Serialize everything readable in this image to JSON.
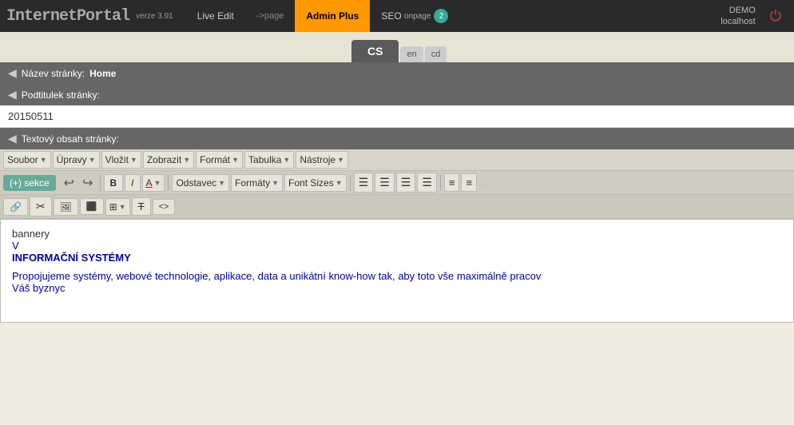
{
  "logo": {
    "text": "InternetPortal",
    "version_label": "verze 3.91"
  },
  "topnav": {
    "live_edit": "Live Edit",
    "arrow_page": "->page",
    "admin_plus": "Admin Plus",
    "seo": "SEO",
    "seo_sub": "onpage",
    "seo_count": "2",
    "demo_label": "DEMO",
    "localhost_label": "localhost",
    "power_icon": "⏻"
  },
  "lang_tabs": {
    "active": "CS",
    "options": [
      "en",
      "cd"
    ]
  },
  "fields": {
    "page_name_label": "Název stránky:",
    "page_name_value": "Home",
    "subtitle_label": "Podtitulek stránky:",
    "subtitle_value": "20150511",
    "content_label": "Textový obsah stránky:"
  },
  "toolbar_row1": {
    "soubor": "Soubor",
    "upravy": "Úpravy",
    "vlozit": "Vložit",
    "zobrazit": "Zobrazit",
    "format": "Formát",
    "tabulka": "Tabulka",
    "nastroje": "Nástroje"
  },
  "toolbar_row2": {
    "sekce": "(+) sekce",
    "undo": "↩",
    "redo": "↪",
    "bold": "B",
    "italic": "I",
    "color_label": "A",
    "paragraph_label": "Odstavec",
    "formats_label": "Formáty",
    "font_sizes_label": "Font Sizes",
    "align_left": "≡",
    "align_center": "≡",
    "align_right": "≡",
    "align_justify": "≡",
    "list_ul": "≡",
    "list_ol": "≡"
  },
  "toolbar_row3": {
    "link": "🔗",
    "unlink": "✂",
    "image": "🖼",
    "media": "⬛",
    "table": "⊞",
    "clear_format": "T̶",
    "source": "<>"
  },
  "editor_content": {
    "line1": "bannery",
    "line2": "V",
    "line3": "INFORMAČNÍ SYSTÉMY",
    "line4": "Propojujeme systémy, webové technologie, aplikace, data a unikátní know-how tak, aby toto vše maximálně pracov",
    "line5": "Váš byznyc"
  }
}
